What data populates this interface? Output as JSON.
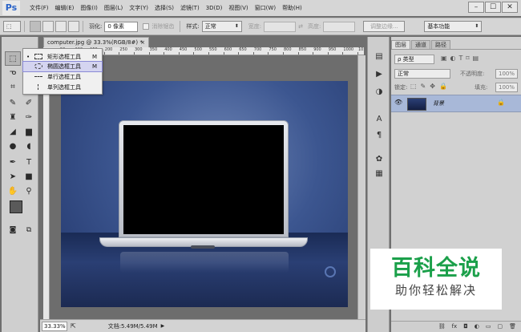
{
  "app": {
    "logo": "Ps"
  },
  "menu": [
    "文件(F)",
    "编辑(E)",
    "图像(I)",
    "图层(L)",
    "文字(Y)",
    "选择(S)",
    "滤镜(T)",
    "3D(D)",
    "视图(V)",
    "窗口(W)",
    "帮助(H)"
  ],
  "window_controls": {
    "minimize": "–",
    "maximize": "☐",
    "close": "✕"
  },
  "options": {
    "feather_label": "羽化:",
    "feather_value": "0 像素",
    "antialias_label": "消除锯齿",
    "style_label": "样式:",
    "style_value": "正常",
    "width_label": "宽度:",
    "height_label": "高度:",
    "refine_edge_button": "调整边缘...",
    "workspace_value": "基本功能"
  },
  "flyout": [
    {
      "label": "矩形选框工具",
      "key": "M",
      "icon": "rect-marquee-icon",
      "current": true,
      "selected": false
    },
    {
      "label": "椭圆选框工具",
      "key": "M",
      "icon": "ellipse-marquee-icon",
      "current": false,
      "selected": true
    },
    {
      "label": "单行选框工具",
      "key": "",
      "icon": "row-marquee-icon",
      "current": false,
      "selected": false
    },
    {
      "label": "单列选框工具",
      "key": "",
      "icon": "column-marquee-icon",
      "current": false,
      "selected": false
    }
  ],
  "document": {
    "tab_title": "computer.jpg @ 33.3%(RGB/8#) *",
    "tab_close": "×",
    "ruler_ticks": [
      "50",
      "100",
      "150",
      "200",
      "250",
      "300",
      "350",
      "400",
      "450",
      "500",
      "550",
      "600",
      "650",
      "700",
      "750",
      "800",
      "850",
      "900",
      "950",
      "1000",
      "1050"
    ],
    "zoom": "33.33%",
    "doc_info": "文档:5.49M/5.49M"
  },
  "layers_panel": {
    "tabs": [
      "图层",
      "通道",
      "路径"
    ],
    "kind_label": "ρ 类型",
    "blend_mode": "正常",
    "opacity_label": "不透明度:",
    "opacity_value": "100%",
    "lock_label": "锁定:",
    "fill_label": "填充:",
    "fill_value": "100%",
    "layer_name": "背景",
    "footer_icons": [
      "link-icon",
      "fx-icon",
      "mask-icon",
      "adjustment-icon",
      "folder-icon",
      "new-layer-icon",
      "trash-icon"
    ]
  },
  "watermark": {
    "title": "百科全说",
    "subtitle": "助你轻松解决"
  },
  "colors": {
    "accent_green": "#1ba04a",
    "selection_blue": "#a8b8d8"
  }
}
